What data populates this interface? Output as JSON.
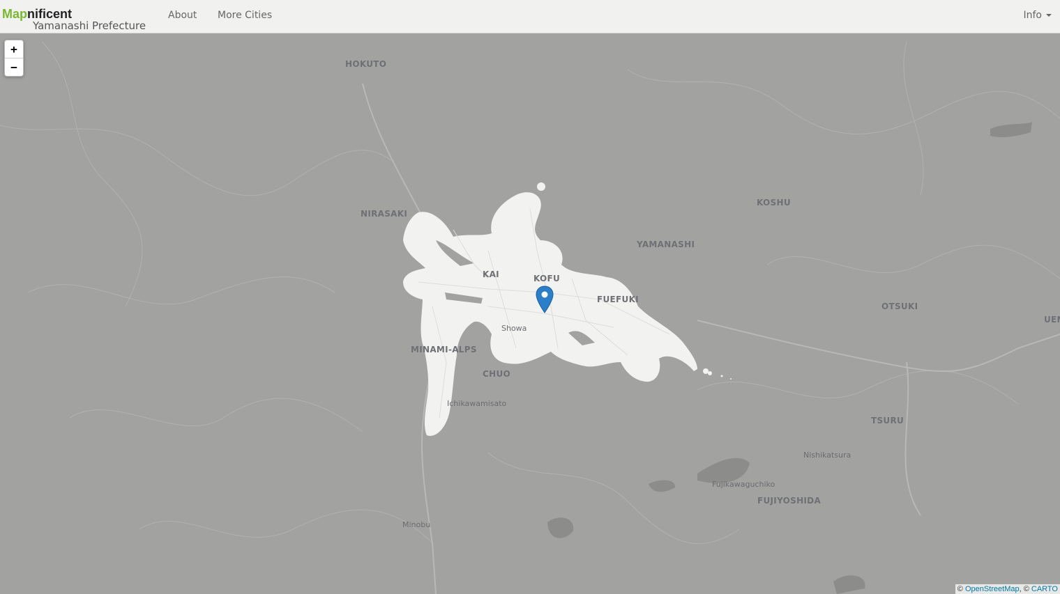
{
  "app": {
    "brand_prefix": "Map",
    "brand_suffix": "nificent",
    "region": "Yamanashi Prefecture"
  },
  "nav": {
    "about": "About",
    "more_cities": "More Cities",
    "info": "Info"
  },
  "zoom": {
    "in": "+",
    "out": "−"
  },
  "colors": {
    "brand_green": "#7ab833",
    "map_base": "#a2a3a1",
    "reach_area": "#f2f3f1",
    "marker": "#2a7fc8"
  },
  "labels": [
    {
      "id": "hokuto",
      "text": "HOKUTO",
      "size": "big"
    },
    {
      "id": "nirasaki",
      "text": "NIRASAKI",
      "size": "big"
    },
    {
      "id": "kai",
      "text": "KAI",
      "size": "big"
    },
    {
      "id": "kofu",
      "text": "KOFU",
      "size": "big"
    },
    {
      "id": "koshu",
      "text": "KOSHU",
      "size": "big"
    },
    {
      "id": "yamanashi",
      "text": "YAMANASHI",
      "size": "big"
    },
    {
      "id": "fuefuki",
      "text": "FUEFUKI",
      "size": "big"
    },
    {
      "id": "showa",
      "text": "Showa",
      "size": "small"
    },
    {
      "id": "minami_alps",
      "text": "MINAMI-ALPS",
      "size": "big"
    },
    {
      "id": "chuo",
      "text": "CHUO",
      "size": "big"
    },
    {
      "id": "ichikawamisato",
      "text": "Ichikawamisato",
      "size": "small"
    },
    {
      "id": "otsuki",
      "text": "OTSUKI",
      "size": "big"
    },
    {
      "id": "uen",
      "text": "UEN",
      "size": "big"
    },
    {
      "id": "tsuru",
      "text": "TSURU",
      "size": "big"
    },
    {
      "id": "nishikatsura",
      "text": "Nishikatsura",
      "size": "small"
    },
    {
      "id": "fujikawaguchiko",
      "text": "Fujikawaguchiko",
      "size": "small"
    },
    {
      "id": "fujiyoshida",
      "text": "FUJIYOSHIDA",
      "size": "big"
    },
    {
      "id": "minobu",
      "text": "Minobu",
      "size": "small"
    }
  ],
  "attribution": {
    "prefix": "© ",
    "osm": "OpenStreetMap",
    "sep": ", © ",
    "carto": "CARTO"
  }
}
